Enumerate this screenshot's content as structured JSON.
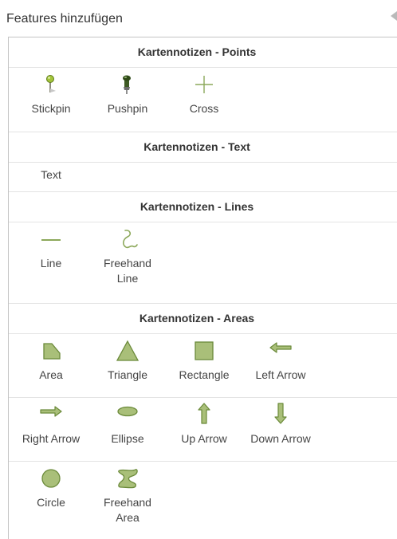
{
  "panel": {
    "title": "Features hinzufügen",
    "collapse_button": "collapse-arrow-icon"
  },
  "colors": {
    "symbol_fill": "#a9bf79",
    "symbol_stroke": "#6b8a3a",
    "header_text": "#333333",
    "label_text": "#444444",
    "divider": "#e3e3e3"
  },
  "groups": {
    "points": {
      "header": "Kartennotizen - Points",
      "items": [
        {
          "label": "Stickpin",
          "icon": "stickpin-icon"
        },
        {
          "label": "Pushpin",
          "icon": "pushpin-icon"
        },
        {
          "label": "Cross",
          "icon": "cross-icon"
        }
      ]
    },
    "text": {
      "header": "Kartennotizen - Text",
      "items": [
        {
          "label": "Text",
          "icon": "text-icon"
        }
      ]
    },
    "lines": {
      "header": "Kartennotizen - Lines",
      "items": [
        {
          "label": "Line",
          "icon": "line-icon"
        },
        {
          "label": "Freehand\nLine",
          "icon": "freehand-line-icon"
        }
      ]
    },
    "areas": {
      "header": "Kartennotizen - Areas",
      "items": [
        {
          "label": "Area",
          "icon": "area-icon"
        },
        {
          "label": "Triangle",
          "icon": "triangle-icon"
        },
        {
          "label": "Rectangle",
          "icon": "rectangle-icon"
        },
        {
          "label": "Left Arrow",
          "icon": "left-arrow-icon"
        },
        {
          "label": "Right Arrow",
          "icon": "right-arrow-icon"
        },
        {
          "label": "Ellipse",
          "icon": "ellipse-icon"
        },
        {
          "label": "Up Arrow",
          "icon": "up-arrow-icon"
        },
        {
          "label": "Down Arrow",
          "icon": "down-arrow-icon"
        },
        {
          "label": "Circle",
          "icon": "circle-icon"
        },
        {
          "label": "Freehand\nArea",
          "icon": "freehand-area-icon"
        }
      ]
    }
  }
}
